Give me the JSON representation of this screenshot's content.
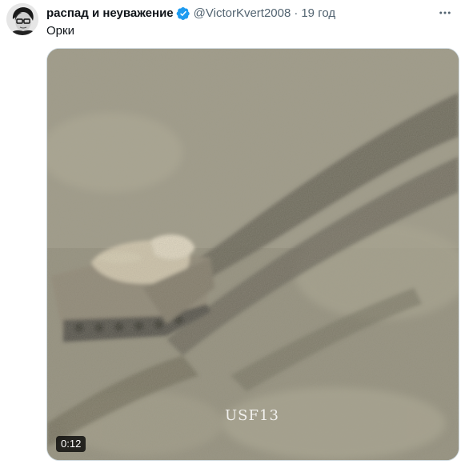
{
  "tweet": {
    "display_name": "распад и неуважение",
    "handle": "@VictorKvert2008",
    "separator": "·",
    "time": "19 год",
    "text": "Орки",
    "verified": true
  },
  "media": {
    "watermark": "USF13",
    "duration": "0:12"
  },
  "colors": {
    "accent": "#1d9bf0",
    "text_primary": "#0f1419",
    "text_secondary": "#536471"
  },
  "icons": {
    "verified": "verified-badge-icon",
    "more": "more-options-icon"
  }
}
